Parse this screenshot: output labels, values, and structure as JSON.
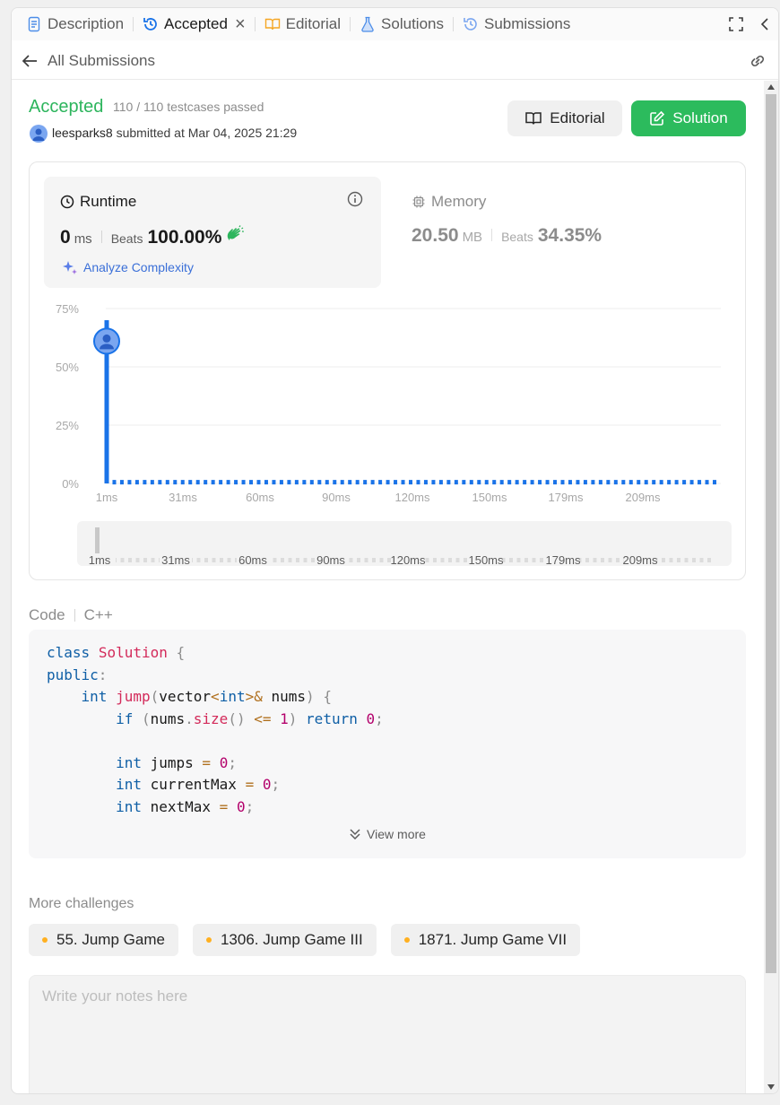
{
  "tabs": {
    "description": "Description",
    "accepted": "Accepted",
    "editorial": "Editorial",
    "solutions": "Solutions",
    "submissions": "Submissions"
  },
  "subbar": {
    "back_label": "All Submissions"
  },
  "result": {
    "status": "Accepted",
    "testcases": "110 / 110 testcases passed",
    "username": "leesparks8",
    "submitted_text": "submitted at Mar 04, 2025 21:29",
    "editorial_btn": "Editorial",
    "solution_btn": "Solution"
  },
  "runtime": {
    "title": "Runtime",
    "value": "0",
    "unit": "ms",
    "beats_label": "Beats",
    "beats_pct": "100.00%",
    "analyze_label": "Analyze Complexity"
  },
  "memory": {
    "title": "Memory",
    "value": "20.50",
    "unit": "MB",
    "beats_label": "Beats",
    "beats_pct": "34.35%"
  },
  "chart_data": {
    "type": "bar",
    "y_ticks": [
      "75%",
      "50%",
      "25%",
      "0%"
    ],
    "ylim": [
      0,
      75
    ],
    "x_ticks": [
      "1ms",
      "31ms",
      "60ms",
      "90ms",
      "120ms",
      "150ms",
      "179ms",
      "209ms"
    ],
    "values": [
      70,
      1.5,
      1.5,
      1.5,
      1.5,
      1.5,
      1.5,
      1.5,
      1.5,
      1.5,
      1.5,
      1.5,
      1.5,
      1.5,
      1.5,
      1.5,
      1.5,
      1.5,
      1.5,
      1.5,
      1.5,
      1.5,
      1.5,
      1.5,
      1.5,
      1.5,
      1.5,
      1.5,
      1.5,
      1.5,
      1.5,
      1.5,
      1.5,
      1.5,
      1.5,
      1.5,
      1.5,
      1.5,
      1.5,
      1.5,
      1.5,
      1.5,
      1.5,
      1.5,
      1.5,
      1.5,
      1.5,
      1.5,
      1.5,
      1.5,
      1.5,
      1.5,
      1.5,
      1.5,
      1.5,
      1.5,
      1.5,
      1.5,
      1.5,
      1.5,
      1.5,
      1.5,
      1.5,
      1.5,
      1.5,
      1.5,
      1.5,
      1.5,
      1.5,
      1.5,
      1.5,
      1.5,
      1.5,
      1.5,
      1.5,
      1.5,
      1.5,
      1.5,
      1.5,
      1.5,
      1.5
    ],
    "marker_value": 61,
    "bar_color": "#1a73e8",
    "brush_ticks": [
      "1ms",
      "31ms",
      "60ms",
      "90ms",
      "120ms",
      "150ms",
      "179ms",
      "209ms"
    ]
  },
  "code": {
    "label": "Code",
    "language": "C++",
    "view_more": "View more"
  },
  "more": {
    "label": "More challenges",
    "items": [
      "55. Jump Game",
      "1306. Jump Game III",
      "1871. Jump Game VII"
    ]
  },
  "notes": {
    "placeholder": "Write your notes here"
  }
}
